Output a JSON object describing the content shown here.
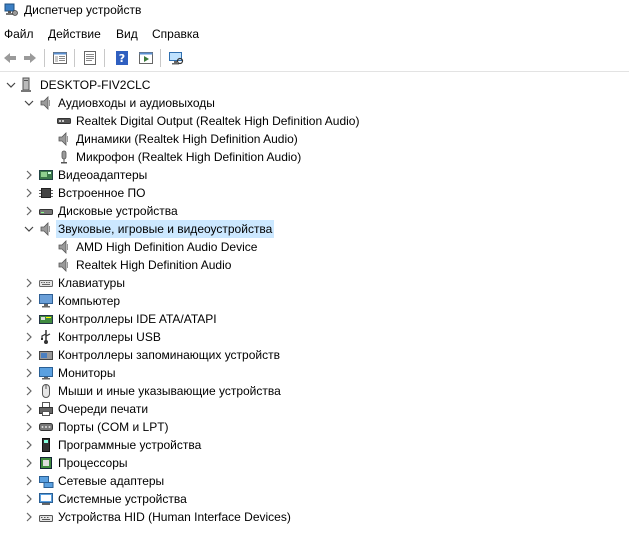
{
  "window": {
    "title": "Диспетчер устройств"
  },
  "menu": [
    "Файл",
    "Действие",
    "Вид",
    "Справка"
  ],
  "toolbar": [
    "back-icon",
    "forward-icon",
    "show-hide-tree-icon",
    "properties-icon",
    "help-icon",
    "run-icon",
    "scan-hardware-icon"
  ],
  "tree": {
    "root": "DESKTOP-FIV2CLC",
    "items": [
      {
        "label": "Аудиовходы и аудиовыходы",
        "icon": "speaker-icon",
        "expanded": true,
        "children": [
          {
            "label": "Realtek Digital Output (Realtek High Definition Audio)",
            "icon": "digital-output-icon"
          },
          {
            "label": "Динамики (Realtek High Definition Audio)",
            "icon": "speaker-icon"
          },
          {
            "label": "Микрофон (Realtek High Definition Audio)",
            "icon": "microphone-icon"
          }
        ]
      },
      {
        "label": "Видеоадаптеры",
        "icon": "display-adapter-icon"
      },
      {
        "label": "Встроенное ПО",
        "icon": "firmware-icon"
      },
      {
        "label": "Дисковые устройства",
        "icon": "disk-drive-icon"
      },
      {
        "label": "Звуковые, игровые и видеоустройства",
        "icon": "speaker-icon",
        "expanded": true,
        "selected": true,
        "children": [
          {
            "label": "AMD High Definition Audio Device",
            "icon": "speaker-icon"
          },
          {
            "label": "Realtek High Definition Audio",
            "icon": "speaker-icon"
          }
        ]
      },
      {
        "label": "Клавиатуры",
        "icon": "keyboard-icon"
      },
      {
        "label": "Компьютер",
        "icon": "computer-icon"
      },
      {
        "label": "Контроллеры IDE ATA/ATAPI",
        "icon": "ide-controller-icon"
      },
      {
        "label": "Контроллеры USB",
        "icon": "usb-icon"
      },
      {
        "label": "Контроллеры запоминающих устройств",
        "icon": "storage-controller-icon"
      },
      {
        "label": "Мониторы",
        "icon": "monitor-icon"
      },
      {
        "label": "Мыши и иные указывающие устройства",
        "icon": "mouse-icon"
      },
      {
        "label": "Очереди печати",
        "icon": "printer-icon"
      },
      {
        "label": "Порты (COM и LPT)",
        "icon": "port-icon"
      },
      {
        "label": "Программные устройства",
        "icon": "software-device-icon"
      },
      {
        "label": "Процессоры",
        "icon": "processor-icon"
      },
      {
        "label": "Сетевые адаптеры",
        "icon": "network-adapter-icon"
      },
      {
        "label": "Системные устройства",
        "icon": "system-device-icon"
      },
      {
        "label": "Устройства HID (Human Interface Devices)",
        "icon": "hid-icon"
      }
    ]
  }
}
